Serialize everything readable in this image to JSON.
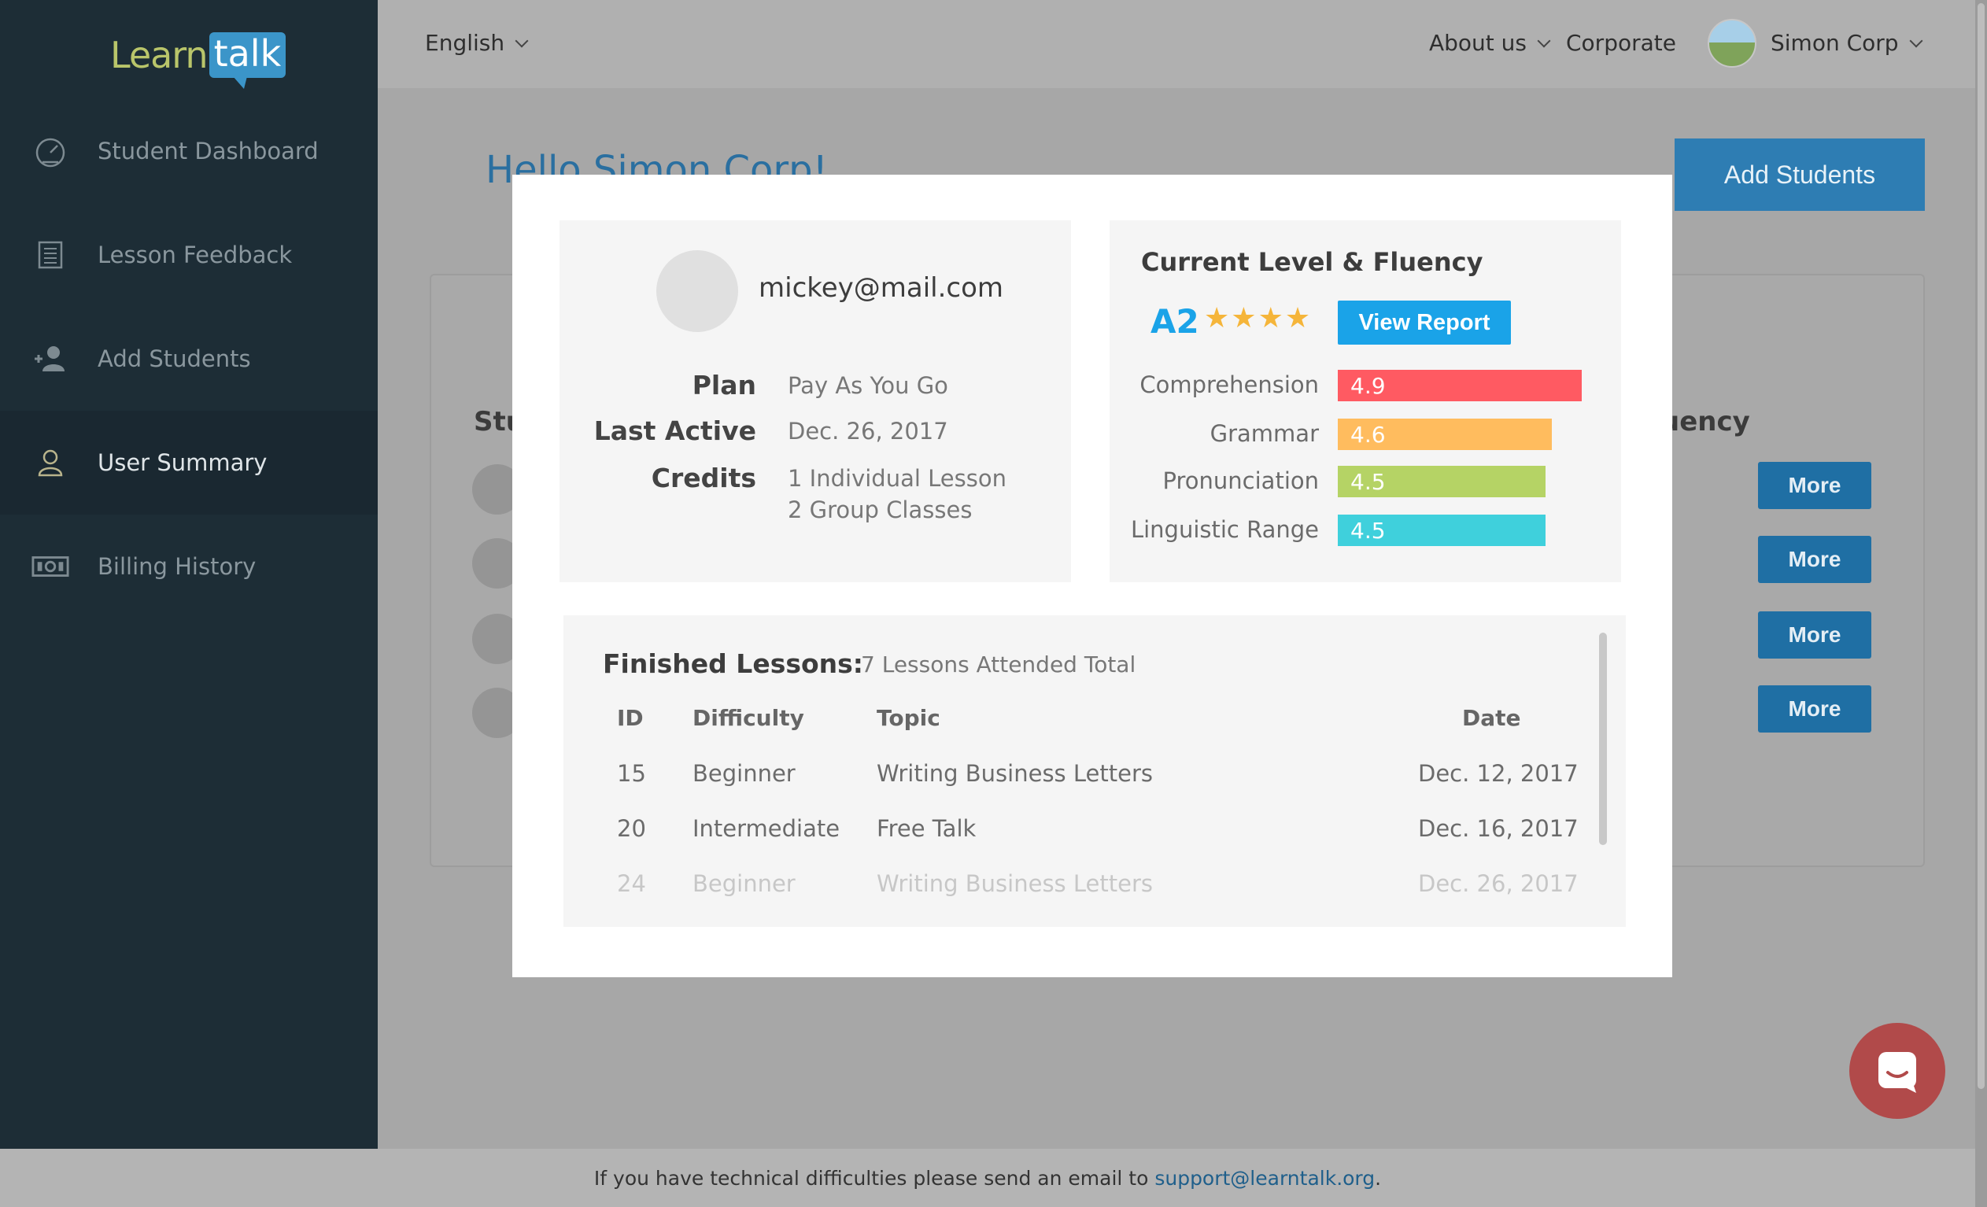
{
  "logo": {
    "part1": "Learn",
    "part2": "talk"
  },
  "sidebar": {
    "items": [
      {
        "label": "Student Dashboard",
        "icon": "speedometer-icon"
      },
      {
        "label": "Lesson Feedback",
        "icon": "document-list-icon"
      },
      {
        "label": "Add Students",
        "icon": "add-user-icon"
      },
      {
        "label": "User Summary",
        "icon": "user-icon",
        "active": true
      },
      {
        "label": "Billing History",
        "icon": "banknote-icon"
      }
    ]
  },
  "topbar": {
    "language": "English",
    "about": "About us",
    "corporate": "Corporate",
    "account": "Simon Corp"
  },
  "page": {
    "greeting": "Hello Simon Corp!",
    "add_students": "Add Students",
    "students_heading": "Stu",
    "fluency_heading": "uency",
    "more_label": "More"
  },
  "modal": {
    "profile": {
      "email": "mickey@mail.com",
      "plan_label": "Plan",
      "plan_value": "Pay As You Go",
      "last_active_label": "Last Active",
      "last_active_value": "Dec. 26, 2017",
      "credits_label": "Credits",
      "credits_line1": "1 Individual Lesson",
      "credits_line2": "2 Group Classes"
    },
    "fluency": {
      "title": "Current Level & Fluency",
      "level": "A2",
      "stars": 4,
      "view_report": "View Report",
      "skills": [
        {
          "name": "Comprehension",
          "score": "4.9",
          "color": "#ff5a62"
        },
        {
          "name": "Grammar",
          "score": "4.6",
          "color": "#ffbc5e"
        },
        {
          "name": "Pronunciation",
          "score": "4.5",
          "color": "#b5d365"
        },
        {
          "name": "Linguistic Range",
          "score": "4.5",
          "color": "#3fd0dc"
        }
      ]
    },
    "lessons": {
      "title": "Finished Lessons:",
      "total": "7 Lessons Attended Total",
      "columns": {
        "id": "ID",
        "difficulty": "Difficulty",
        "topic": "Topic",
        "date": "Date"
      },
      "rows": [
        {
          "id": "15",
          "difficulty": "Beginner",
          "topic": "Writing Business Letters",
          "date": "Dec. 12, 2017"
        },
        {
          "id": "20",
          "difficulty": "Intermediate",
          "topic": "Free Talk",
          "date": "Dec. 16, 2017"
        },
        {
          "id": "24",
          "difficulty": "Beginner",
          "topic": "Writing Business Letters",
          "date": "Dec. 26, 2017"
        }
      ]
    }
  },
  "footer": {
    "text": "If you have technical difficulties please send an email to ",
    "email": "support@learntalk.org",
    "end": "."
  }
}
